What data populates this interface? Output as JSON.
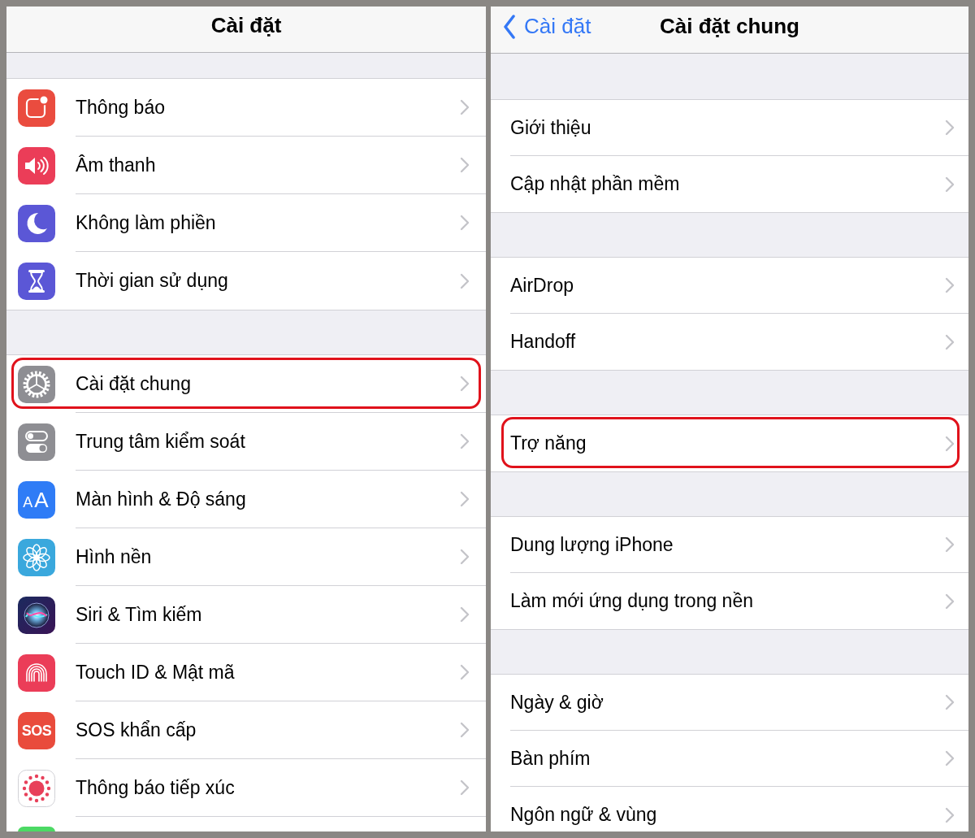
{
  "screens": [
    {
      "nav": {
        "title": "Cài đặt"
      },
      "groups": [
        {
          "rows": [
            {
              "label": "Thông báo",
              "highlighted": false
            },
            {
              "label": "Âm thanh",
              "highlighted": false
            },
            {
              "label": "Không làm phiền",
              "highlighted": false
            },
            {
              "label": "Thời gian sử dụng",
              "highlighted": false
            }
          ]
        },
        {
          "rows": [
            {
              "label": "Cài đặt chung",
              "highlighted": true
            },
            {
              "label": "Trung tâm kiểm soát",
              "highlighted": false
            },
            {
              "label": "Màn hình & Độ sáng",
              "icon_text": "AA",
              "highlighted": false
            },
            {
              "label": "Hình nền",
              "highlighted": false
            },
            {
              "label": "Siri & Tìm kiếm",
              "highlighted": false
            },
            {
              "label": "Touch ID & Mật mã",
              "highlighted": false
            },
            {
              "label": "SOS khẩn cấp",
              "icon_text": "SOS",
              "highlighted": false
            },
            {
              "label": "Thông báo tiếp xúc",
              "highlighted": false
            },
            {
              "highlighted": false
            }
          ]
        }
      ]
    },
    {
      "nav": {
        "back": "Cài đặt",
        "title": "Cài đặt chung"
      },
      "groups": [
        {
          "rows": [
            {
              "label": "Giới thiệu",
              "highlighted": false
            },
            {
              "label": "Cập nhật phần mềm",
              "highlighted": false
            }
          ]
        },
        {
          "rows": [
            {
              "label": "AirDrop",
              "highlighted": false
            },
            {
              "label": "Handoff",
              "highlighted": false
            }
          ]
        },
        {
          "rows": [
            {
              "label": "Trợ năng",
              "highlighted": true
            }
          ]
        },
        {
          "rows": [
            {
              "label": "Dung lượng iPhone",
              "highlighted": false
            },
            {
              "label": "Làm mới ứng dụng trong nền",
              "highlighted": false
            }
          ]
        },
        {
          "rows": [
            {
              "label": "Ngày & giờ",
              "highlighted": false
            },
            {
              "label": "Bàn phím",
              "highlighted": false
            },
            {
              "label": "Ngôn ngữ & vùng",
              "highlighted": false
            }
          ]
        }
      ]
    }
  ]
}
